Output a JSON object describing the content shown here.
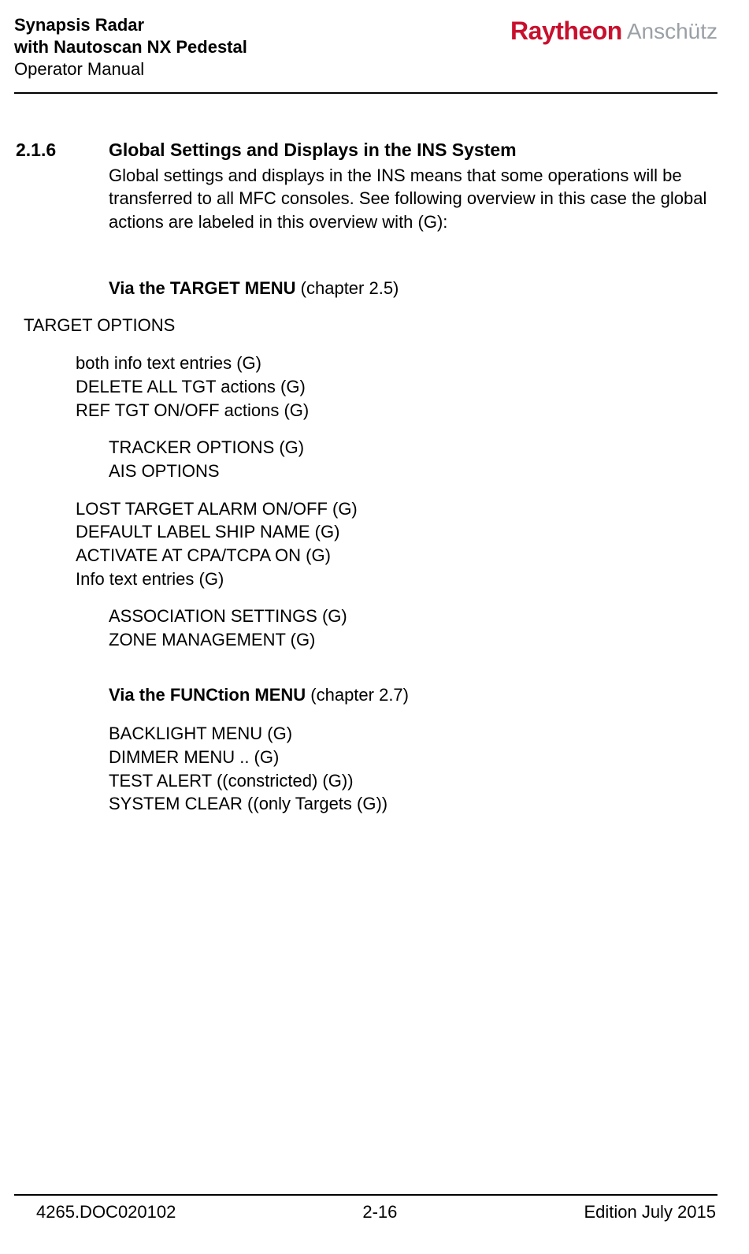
{
  "header": {
    "title1": "Synapsis Radar",
    "title2": "with Nautoscan NX Pedestal",
    "title3": "Operator Manual",
    "brand_primary": "Raytheon",
    "brand_secondary": "Anschütz"
  },
  "section": {
    "number": "2.1.6",
    "title": "Global Settings and Displays in the INS System",
    "intro": "Global settings and displays in the INS means that some operations will be transferred to all MFC consoles. See following overview in this case the global actions are labeled in this overview with (G):",
    "target_menu_label_bold": "Via the TARGET MENU",
    "target_menu_label_tail": " (chapter 2.5)",
    "target_options": "TARGET OPTIONS",
    "target_list": [
      "both info text entries (G)",
      "DELETE ALL TGT actions (G)",
      "REF TGT ON/OFF actions (G)"
    ],
    "tracker_options": "TRACKER OPTIONS (G)",
    "ais_options": "AIS OPTIONS",
    "ais_list": [
      "LOST TARGET ALARM ON/OFF (G)",
      "DEFAULT LABEL SHIP NAME (G)",
      "ACTIVATE AT CPA/TCPA ON (G)",
      "Info text entries (G)"
    ],
    "association": "ASSOCIATION SETTINGS (G)",
    "zone": "ZONE MANAGEMENT (G)",
    "function_menu_label_bold": "Via the FUNCtion MENU",
    "function_menu_label_tail": " (chapter 2.7)",
    "func_list": [
      "BACKLIGHT MENU (G)",
      "DIMMER MENU .. (G)",
      "TEST ALERT ((constricted) (G))",
      "SYSTEM CLEAR ((only Targets (G))"
    ]
  },
  "footer": {
    "doc_id": "4265.DOC020102",
    "page": "2-16",
    "edition": "Edition July 2015"
  }
}
